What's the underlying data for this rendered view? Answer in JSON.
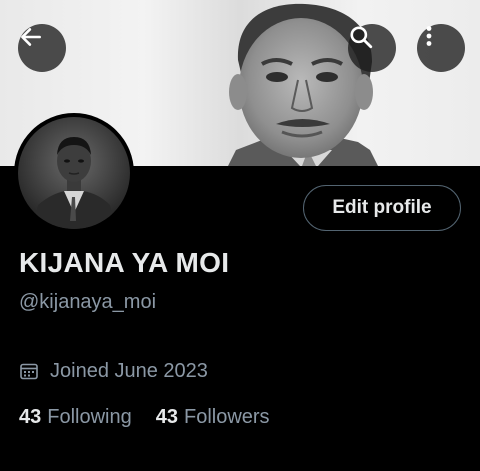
{
  "header": {
    "back_icon": "arrow-left-icon",
    "search_icon": "search-icon",
    "more_icon": "more-vertical-icon"
  },
  "profile": {
    "edit_button_label": "Edit profile",
    "display_name": "KIJANA YA MOI",
    "handle": "@kijanaya_moi",
    "joined_icon": "calendar-icon",
    "joined_text": "Joined June 2023",
    "following_count": "43",
    "following_label": "Following",
    "followers_count": "43",
    "followers_label": "Followers"
  },
  "colors": {
    "background": "#000000",
    "primary_text": "#e7e9ea",
    "secondary_text": "#8b98a5",
    "button_border": "#536471"
  }
}
